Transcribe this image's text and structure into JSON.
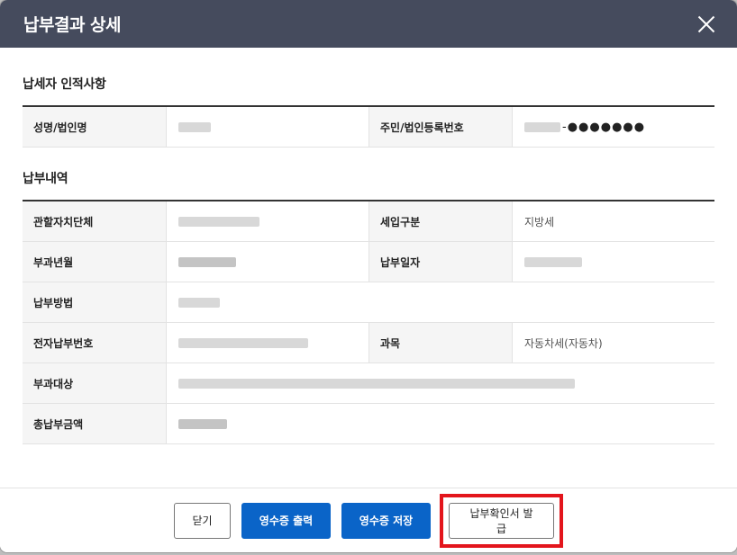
{
  "modal": {
    "title": "납부결과 상세",
    "close_icon": "close-icon"
  },
  "taxpayer": {
    "section_title": "납세자 인적사항",
    "name_label": "성명/법인명",
    "id_label": "주민/법인등록번호",
    "id_masked_suffix": "-●●●●●●●"
  },
  "payment": {
    "section_title": "납부내역",
    "rows": {
      "jurisdiction_label": "관할자치단체",
      "revenue_type_label": "세입구분",
      "revenue_type_value": "지방세",
      "levy_month_label": "부과년월",
      "payment_date_label": "납부일자",
      "method_label": "납부방법",
      "epay_number_label": "전자납부번호",
      "subject_label": "과목",
      "subject_value": "자동차세(자동차)",
      "target_label": "부과대상",
      "total_label": "총납부금액"
    }
  },
  "footer": {
    "close_label": "닫기",
    "print_receipt_label": "영수증 출력",
    "save_receipt_label": "영수증 저장",
    "issue_certificate_label": "납부확인서 발급"
  },
  "colors": {
    "header_bg": "#454b5d",
    "primary": "#0a64c8",
    "highlight": "#e3151c"
  }
}
